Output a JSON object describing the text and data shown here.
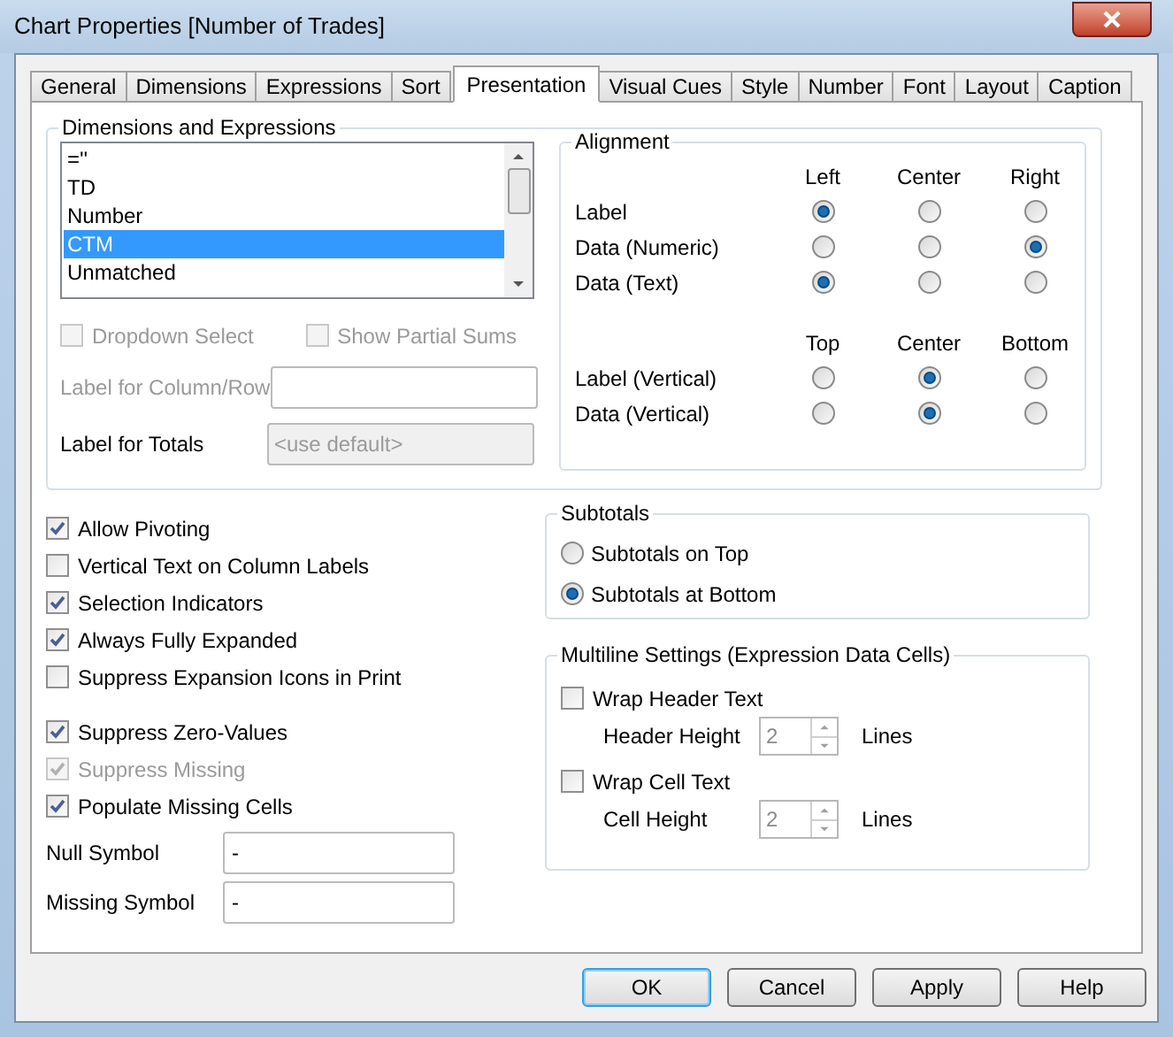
{
  "window": {
    "title": "Chart Properties [Number of Trades]"
  },
  "tabs": [
    {
      "label": "General",
      "selected": false
    },
    {
      "label": "Dimensions",
      "selected": false
    },
    {
      "label": "Expressions",
      "selected": false
    },
    {
      "label": "Sort",
      "selected": false
    },
    {
      "label": "Presentation",
      "selected": true
    },
    {
      "label": "Visual Cues",
      "selected": false
    },
    {
      "label": "Style",
      "selected": false
    },
    {
      "label": "Number",
      "selected": false
    },
    {
      "label": "Font",
      "selected": false
    },
    {
      "label": "Layout",
      "selected": false
    },
    {
      "label": "Caption",
      "selected": false
    }
  ],
  "dimensions_group": {
    "title": "Dimensions and Expressions",
    "list": [
      {
        "label": "=''",
        "selected": false
      },
      {
        "label": "TD",
        "selected": false
      },
      {
        "label": "Number",
        "selected": false
      },
      {
        "label": "CTM",
        "selected": true
      },
      {
        "label": "Unmatched",
        "selected": false
      }
    ],
    "checkboxes": [
      {
        "label": "Dropdown Select",
        "checked": false,
        "disabled": true
      },
      {
        "label": "Show Partial Sums",
        "checked": false,
        "disabled": true
      }
    ],
    "fields": [
      {
        "label": "Label for Column/Row",
        "disabled": true
      },
      {
        "label": "Label for Totals",
        "placeholder": "<use default>",
        "disabled": false
      }
    ],
    "alignment": {
      "title": "Alignment",
      "horizontal": {
        "columns": [
          "Left",
          "Center",
          "Right"
        ],
        "rows": [
          {
            "label": "Label",
            "options": [
              {
                "selected": true
              },
              {
                "selected": false
              },
              {
                "selected": false
              }
            ]
          },
          {
            "label": "Data (Numeric)",
            "options": [
              {
                "selected": false
              },
              {
                "selected": false
              },
              {
                "selected": true
              }
            ]
          },
          {
            "label": "Data (Text)",
            "options": [
              {
                "selected": true
              },
              {
                "selected": false
              },
              {
                "selected": false
              }
            ]
          }
        ]
      },
      "vertical": {
        "columns": [
          "Top",
          "Center",
          "Bottom"
        ],
        "rows": [
          {
            "label": "Label (Vertical)",
            "options": [
              {
                "selected": false
              },
              {
                "selected": true
              },
              {
                "selected": false
              }
            ]
          },
          {
            "label": "Data (Vertical)",
            "options": [
              {
                "selected": false
              },
              {
                "selected": true
              },
              {
                "selected": false
              }
            ]
          }
        ]
      }
    }
  },
  "options_primary": [
    {
      "label": "Allow Pivoting",
      "checked": true,
      "disabled": false
    },
    {
      "label": "Vertical Text on Column Labels",
      "checked": false,
      "disabled": false
    },
    {
      "label": "Selection Indicators",
      "checked": true,
      "disabled": false
    },
    {
      "label": "Always Fully Expanded",
      "checked": true,
      "disabled": false
    },
    {
      "label": "Suppress Expansion Icons in Print",
      "checked": false,
      "disabled": false
    }
  ],
  "options_secondary": [
    {
      "label": "Suppress Zero-Values",
      "checked": true,
      "disabled": false
    },
    {
      "label": "Suppress Missing",
      "checked": true,
      "disabled": true
    },
    {
      "label": "Populate Missing Cells",
      "checked": true,
      "disabled": false
    }
  ],
  "symbols": [
    {
      "label": "Null Symbol",
      "value": "-"
    },
    {
      "label": "Missing Symbol",
      "value": "-"
    }
  ],
  "subtotals": {
    "title": "Subtotals",
    "options": [
      {
        "label": "Subtotals on Top",
        "selected": false
      },
      {
        "label": "Subtotals at Bottom",
        "selected": true
      }
    ]
  },
  "multiline": {
    "title": "Multiline Settings (Expression Data Cells)",
    "items": [
      {
        "label": "Wrap Header Text",
        "checked": false,
        "height_label": "Header Height",
        "value": "2",
        "value_disabled": true,
        "unit": "Lines"
      },
      {
        "label": "Wrap Cell Text",
        "checked": false,
        "height_label": "Cell Height",
        "value": "2",
        "value_disabled": true,
        "unit": "Lines"
      }
    ]
  },
  "buttons": [
    {
      "label": "OK",
      "default": true
    },
    {
      "label": "Cancel",
      "default": false
    },
    {
      "label": "Apply",
      "default": false
    },
    {
      "label": "Help",
      "default": false
    }
  ]
}
